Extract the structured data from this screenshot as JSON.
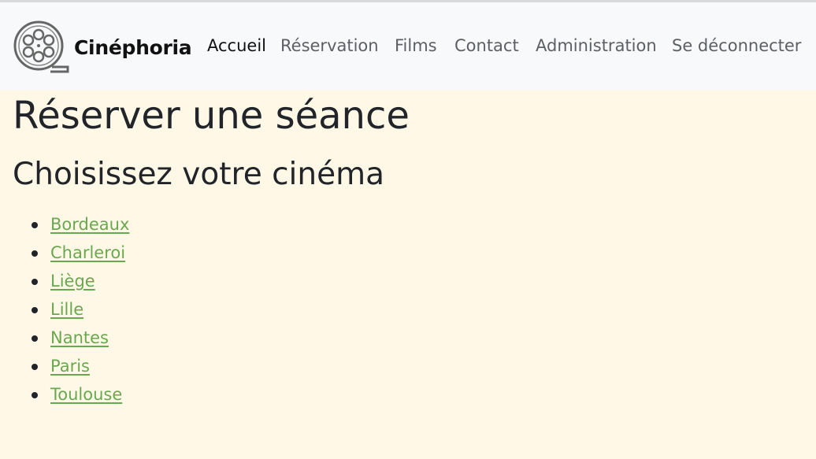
{
  "brand": {
    "name": "Cinéphoria",
    "logo_icon": "film-reel-icon"
  },
  "nav": {
    "items": [
      {
        "label": "Accueil",
        "active": true
      },
      {
        "label": "Réservation",
        "active": false
      },
      {
        "label": "Films",
        "active": false
      },
      {
        "label": "Contact",
        "active": false
      },
      {
        "label": "Administration",
        "active": false
      },
      {
        "label": "Se déconnecter",
        "active": false
      }
    ]
  },
  "main": {
    "title": "Réserver une séance",
    "subtitle": "Choisissez votre cinéma",
    "cinemas": [
      "Bordeaux",
      "Charleroi",
      "Liège",
      "Lille",
      "Nantes",
      "Paris",
      "Toulouse"
    ]
  },
  "colors": {
    "page_background": "#fff8e7",
    "navbar_background": "#f8f9fa",
    "link": "#6aa84f",
    "text": "#212529"
  }
}
